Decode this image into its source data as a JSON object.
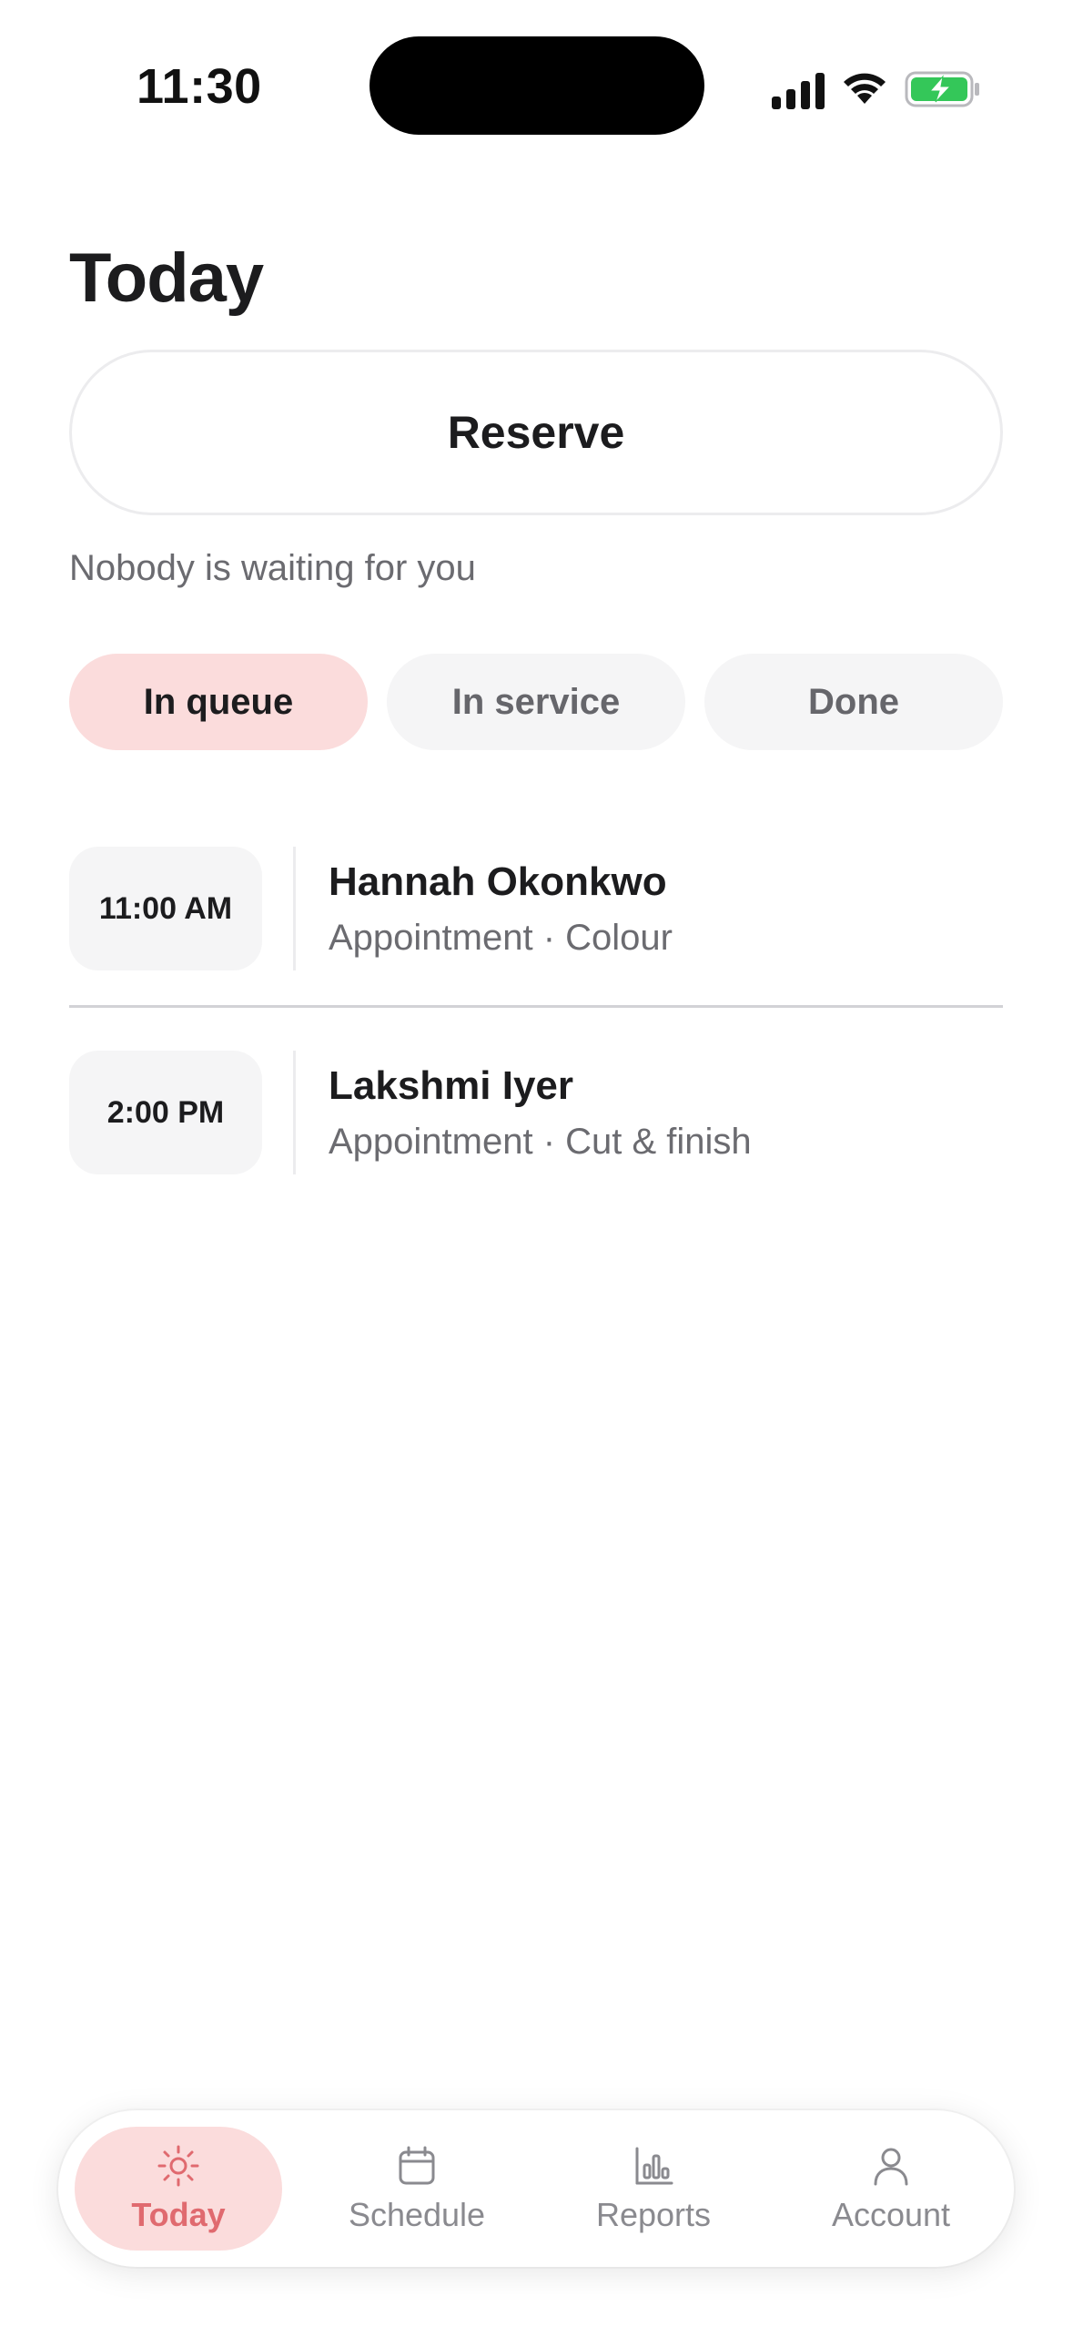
{
  "status_bar": {
    "time": "11:30",
    "icons": [
      "signal-icon",
      "wifi-icon",
      "battery-charging-icon"
    ],
    "battery_color": "#34c759"
  },
  "page": {
    "title": "Today",
    "reserve_label": "Reserve",
    "waiting_text": "Nobody is waiting for you"
  },
  "filters": [
    {
      "label": "In queue",
      "active": true
    },
    {
      "label": "In service",
      "active": false
    },
    {
      "label": "Done",
      "active": false
    }
  ],
  "appointments": [
    {
      "time": "11:00 AM",
      "name": "Hannah Okonkwo",
      "detail": "Appointment · Colour"
    },
    {
      "time": "2:00 PM",
      "name": "Lakshmi Iyer",
      "detail": "Appointment · Cut & finish"
    }
  ],
  "tabbar": [
    {
      "label": "Today",
      "icon": "sun-icon",
      "active": true
    },
    {
      "label": "Schedule",
      "icon": "calendar-icon",
      "active": false
    },
    {
      "label": "Reports",
      "icon": "bar-chart-icon",
      "active": false
    },
    {
      "label": "Account",
      "icon": "person-icon",
      "active": false
    }
  ],
  "colors": {
    "accent": "#e06a6f",
    "accent_bg": "#fbdcdc",
    "chip_bg": "#f5f5f6"
  }
}
